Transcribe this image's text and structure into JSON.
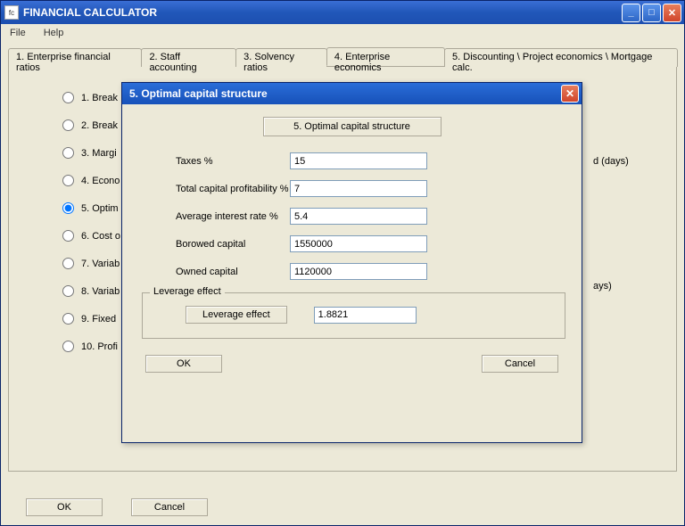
{
  "app": {
    "title": "FINANCIAL CALCULATOR",
    "icon_hint": "app"
  },
  "menu": {
    "file": "File",
    "help": "Help"
  },
  "tabs": [
    "1. Enterprise financial ratios",
    "2. Staff accounting",
    "3. Solvency ratios",
    "4. Enterprise economics",
    "5. Discounting \\ Project economics \\ Mortgage calc."
  ],
  "active_tab_index": 3,
  "radios": [
    {
      "label": "1. Break",
      "selected": false
    },
    {
      "label": "2. Break",
      "selected": false
    },
    {
      "label": "3. Margi",
      "selected": false
    },
    {
      "label": "4. Econo",
      "selected": false
    },
    {
      "label": "5. Optim",
      "selected": true
    },
    {
      "label": "6. Cost o",
      "selected": false
    },
    {
      "label": "7. Variab",
      "selected": false
    },
    {
      "label": "8. Variab",
      "selected": false
    },
    {
      "label": "9. Fixed",
      "selected": false
    },
    {
      "label": "10. Profi",
      "selected": false
    }
  ],
  "main_buttons": {
    "ok": "OK",
    "cancel": "Cancel"
  },
  "obscured_text": {
    "row3": "d (days)",
    "row7": "ays)"
  },
  "dialog": {
    "title": "5. Optimal capital structure",
    "header": "5. Optimal capital structure",
    "fields": {
      "taxes": {
        "label": "Taxes %",
        "value": "15"
      },
      "tcp": {
        "label": "Total capital profitability %",
        "value": "7"
      },
      "air": {
        "label": "Average interest rate %",
        "value": "5.4"
      },
      "borrowed": {
        "label": "Borowed capital",
        "value": "1550000"
      },
      "owned": {
        "label": "Owned capital",
        "value": "1120000"
      }
    },
    "group": {
      "title": "Leverage effect",
      "button": "Leverage effect",
      "output": "1.8821"
    },
    "buttons": {
      "ok": "OK",
      "cancel": "Cancel"
    }
  }
}
